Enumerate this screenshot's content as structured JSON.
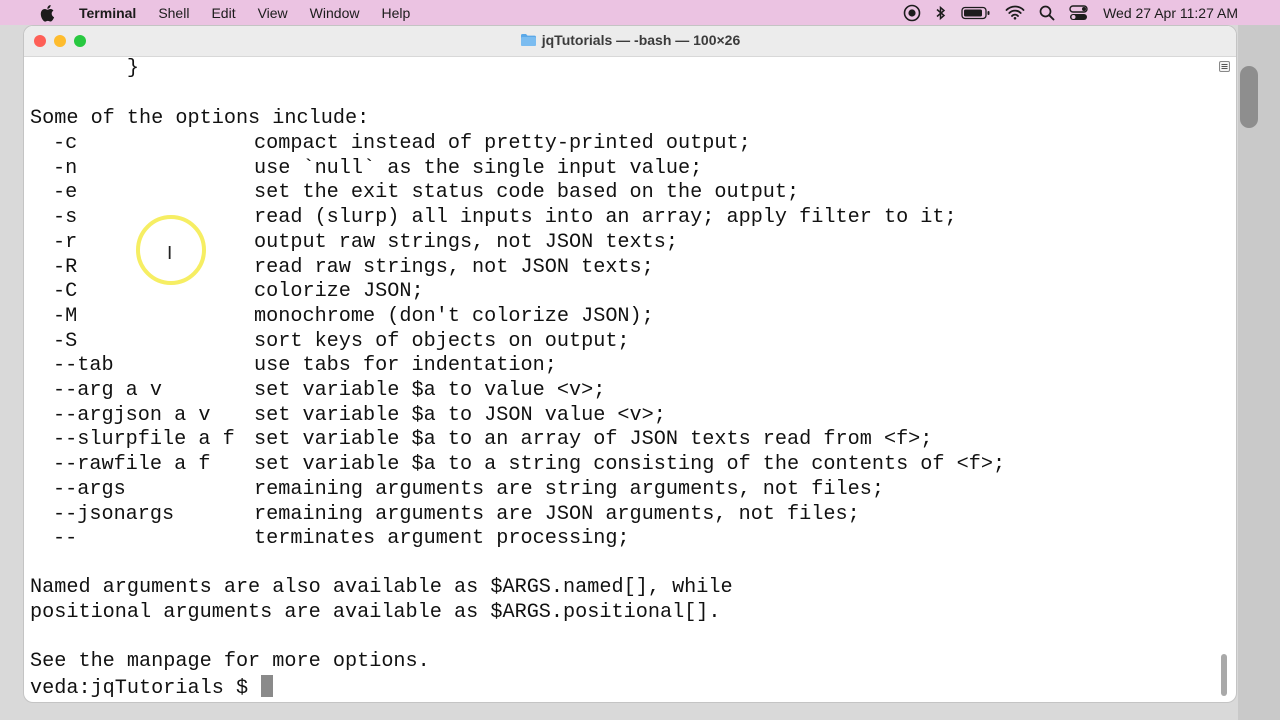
{
  "menubar": {
    "app": "Terminal",
    "items": [
      "Shell",
      "Edit",
      "View",
      "Window",
      "Help"
    ],
    "clock": "Wed 27 Apr  11:27 AM"
  },
  "window": {
    "title": "jqTutorials — -bash — 100×26"
  },
  "terminal": {
    "brace": "        }",
    "options_header": "Some of the options include:",
    "options": [
      {
        "flag": "-c",
        "desc": "compact instead of pretty-printed output;"
      },
      {
        "flag": "-n",
        "desc": "use `null` as the single input value;"
      },
      {
        "flag": "-e",
        "desc": "set the exit status code based on the output;"
      },
      {
        "flag": "-s",
        "desc": "read (slurp) all inputs into an array; apply filter to it;"
      },
      {
        "flag": "-r",
        "desc": "output raw strings, not JSON texts;"
      },
      {
        "flag": "-R",
        "desc": "read raw strings, not JSON texts;"
      },
      {
        "flag": "-C",
        "desc": "colorize JSON;"
      },
      {
        "flag": "-M",
        "desc": "monochrome (don't colorize JSON);"
      },
      {
        "flag": "-S",
        "desc": "sort keys of objects on output;"
      },
      {
        "flag": "--tab",
        "desc": "use tabs for indentation;"
      },
      {
        "flag": "--arg a v",
        "desc": "set variable $a to value <v>;"
      },
      {
        "flag": "--argjson a v",
        "desc": "set variable $a to JSON value <v>;"
      },
      {
        "flag": "--slurpfile a f",
        "desc": "set variable $a to an array of JSON texts read from <f>;"
      },
      {
        "flag": "--rawfile a f",
        "desc": "set variable $a to a string consisting of the contents of <f>;"
      },
      {
        "flag": "--args",
        "desc": "remaining arguments are string arguments, not files;"
      },
      {
        "flag": "--jsonargs",
        "desc": "remaining arguments are JSON arguments, not files;"
      },
      {
        "flag": "--",
        "desc": "terminates argument processing;"
      }
    ],
    "named_line1": "Named arguments are also available as $ARGS.named[], while",
    "named_line2": "positional arguments are available as $ARGS.positional[].",
    "manpage_line": "See the manpage for more options.",
    "prompt": "veda:jqTutorials $ "
  },
  "icons": {
    "apple": "apple-logo-icon",
    "status": [
      "screen-record-icon",
      "bluetooth-icon",
      "battery-icon",
      "wifi-icon",
      "search-icon",
      "control-center-icon"
    ],
    "folder": "folder-icon",
    "cursor": "ibeam-cursor-icon"
  },
  "colors": {
    "menubar": "#ebc3e2",
    "close": "#fe5f57",
    "minimize": "#febc2e",
    "maximize": "#28c840",
    "cursor_highlight": "#f6ee63"
  }
}
